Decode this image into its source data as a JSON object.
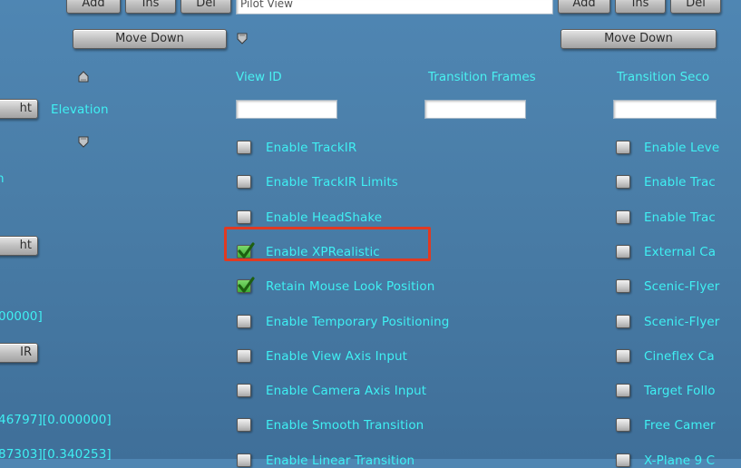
{
  "top_row": {
    "left_buttons": [
      "Add",
      "Ins",
      "Del"
    ],
    "name_field_value": "Pilot View",
    "right_buttons": [
      "Add",
      "Ins",
      "Del"
    ]
  },
  "move_down_left": "Move Down",
  "move_down_right": "Move Down",
  "headers": {
    "view_id": "View ID",
    "transition_frames": "Transition Frames",
    "transition_seconds": "Transition Seco"
  },
  "left_column": {
    "btn_row1": "ht",
    "elevation_label": "Elevation",
    "text_row2": "n",
    "btn_row4": "ht",
    "text_row5": "00000]",
    "btn_row6": "IR",
    "text_row8": "46797][0.000000]",
    "text_row9": "87303][0.340253]"
  },
  "middle_checkboxes": [
    {
      "label": "Enable TrackIR",
      "checked": false
    },
    {
      "label": "Enable TrackIR Limits",
      "checked": false
    },
    {
      "label": "Enable HeadShake",
      "checked": false
    },
    {
      "label": "Enable XPRealistic",
      "checked": true
    },
    {
      "label": "Retain Mouse Look Position",
      "checked": true
    },
    {
      "label": "Enable Temporary Positioning",
      "checked": false
    },
    {
      "label": "Enable View Axis Input",
      "checked": false
    },
    {
      "label": "Enable Camera Axis Input",
      "checked": false
    },
    {
      "label": "Enable Smooth Transition",
      "checked": false
    },
    {
      "label": "Enable Linear Transition",
      "checked": false
    }
  ],
  "right_checkboxes": [
    {
      "label": "Enable Leve",
      "checked": false
    },
    {
      "label": "Enable Trac",
      "checked": false
    },
    {
      "label": "Enable Trac",
      "checked": false
    },
    {
      "label": "External Ca",
      "checked": false
    },
    {
      "label": "Scenic-Flyer",
      "checked": false
    },
    {
      "label": "Scenic-Flyer",
      "checked": false
    },
    {
      "label": "Cineflex Ca",
      "checked": false
    },
    {
      "label": "Target Follo",
      "checked": false
    },
    {
      "label": "Free Camer",
      "checked": false
    },
    {
      "label": "X-Plane 9 C",
      "checked": false
    }
  ],
  "colors": {
    "text": "#3ff0f3",
    "background": "#4a7ea8",
    "highlight": "#e03a22",
    "check": "#1f7a12"
  },
  "icons": {
    "up": "shield-up-icon",
    "down": "shield-down-icon"
  }
}
